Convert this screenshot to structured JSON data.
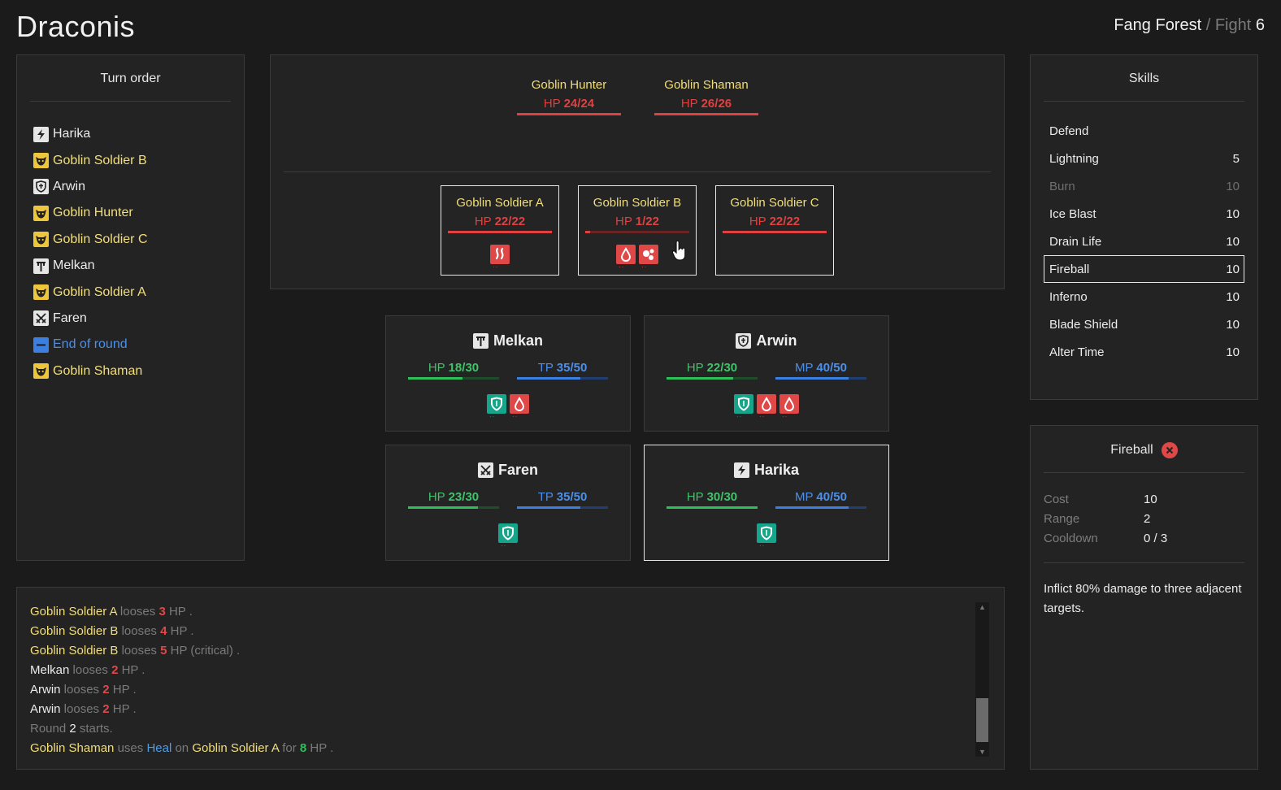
{
  "app": {
    "title": "Draconis"
  },
  "location": {
    "name": "Fang Forest",
    "separator": "/",
    "fight_label": "Fight",
    "fight_number": "6"
  },
  "turn_order": {
    "title": "Turn order",
    "items": [
      {
        "label": "Harika",
        "icon": "lightning-icon",
        "kind": "hero"
      },
      {
        "label": "Goblin Soldier B",
        "icon": "goblin-icon",
        "kind": "enemy"
      },
      {
        "label": "Arwin",
        "icon": "shield-cross-icon",
        "kind": "hero"
      },
      {
        "label": "Goblin Hunter",
        "icon": "goblin-icon",
        "kind": "enemy"
      },
      {
        "label": "Goblin Soldier C",
        "icon": "goblin-icon",
        "kind": "enemy"
      },
      {
        "label": "Melkan",
        "icon": "hammer-icon",
        "kind": "hero"
      },
      {
        "label": "Goblin Soldier A",
        "icon": "goblin-icon",
        "kind": "enemy"
      },
      {
        "label": "Faren",
        "icon": "crossed-swords-icon",
        "kind": "hero"
      },
      {
        "label": "End of round",
        "icon": "dash-icon",
        "kind": "marker"
      },
      {
        "label": "Goblin Shaman",
        "icon": "goblin-icon",
        "kind": "enemy"
      }
    ]
  },
  "enemies_back": [
    {
      "name": "Goblin Hunter",
      "hp_label": "HP",
      "hp": "24/24",
      "hp_fraction": 1.0
    },
    {
      "name": "Goblin Shaman",
      "hp_label": "HP",
      "hp": "26/26",
      "hp_fraction": 1.0
    }
  ],
  "enemies_front": [
    {
      "name": "Goblin Soldier A",
      "hp_label": "HP",
      "hp": "22/22",
      "hp_fraction": 1.0,
      "statuses": [
        {
          "icon": "burn-icon",
          "color": "red"
        }
      ]
    },
    {
      "name": "Goblin Soldier B",
      "hp_label": "HP",
      "hp": "1/22",
      "hp_fraction": 0.045,
      "statuses": [
        {
          "icon": "blood-drop-icon",
          "color": "red"
        },
        {
          "icon": "poison-icon",
          "color": "red"
        }
      ]
    },
    {
      "name": "Goblin Soldier C",
      "hp_label": "HP",
      "hp": "22/22",
      "hp_fraction": 1.0,
      "statuses": []
    }
  ],
  "heroes": {
    "melkan": {
      "name": "Melkan",
      "hp_label": "HP",
      "hp": "18/30",
      "hp_fraction": 0.6,
      "res_label": "TP",
      "res": "35/50",
      "res_fraction": 0.7
    },
    "arwin": {
      "name": "Arwin",
      "hp_label": "HP",
      "hp": "22/30",
      "hp_fraction": 0.73,
      "res_label": "MP",
      "res": "40/50",
      "res_fraction": 0.8
    },
    "faren": {
      "name": "Faren",
      "hp_label": "HP",
      "hp": "23/30",
      "hp_fraction": 0.77,
      "res_label": "TP",
      "res": "35/50",
      "res_fraction": 0.7
    },
    "harika": {
      "name": "Harika",
      "hp_label": "HP",
      "hp": "30/30",
      "hp_fraction": 1.0,
      "res_label": "MP",
      "res": "40/50",
      "res_fraction": 0.8
    }
  },
  "skills": {
    "title": "Skills",
    "items": [
      {
        "name": "Defend",
        "cost": "",
        "disabled": false,
        "selected": false
      },
      {
        "name": "Lightning",
        "cost": "5",
        "disabled": false,
        "selected": false
      },
      {
        "name": "Burn",
        "cost": "10",
        "disabled": true,
        "selected": false
      },
      {
        "name": "Ice Blast",
        "cost": "10",
        "disabled": false,
        "selected": false
      },
      {
        "name": "Drain Life",
        "cost": "10",
        "disabled": false,
        "selected": false
      },
      {
        "name": "Fireball",
        "cost": "10",
        "disabled": false,
        "selected": true
      },
      {
        "name": "Inferno",
        "cost": "10",
        "disabled": false,
        "selected": false
      },
      {
        "name": "Blade Shield",
        "cost": "10",
        "disabled": false,
        "selected": false
      },
      {
        "name": "Alter Time",
        "cost": "10",
        "disabled": false,
        "selected": false
      }
    ]
  },
  "skill_detail": {
    "name": "Fireball",
    "cost_label": "Cost",
    "cost": "10",
    "range_label": "Range",
    "range": "2",
    "cooldown_label": "Cooldown",
    "cooldown": "0 / 3",
    "description": "Inflict 80% damage to three adjacent targets."
  },
  "log": {
    "lines": [
      [
        {
          "t": "Goblin Soldier A",
          "c": "yellow"
        },
        {
          "t": " looses ",
          "c": "gray"
        },
        {
          "t": "3",
          "c": "red"
        },
        {
          "t": " HP .",
          "c": "gray"
        }
      ],
      [
        {
          "t": "Goblin Soldier B",
          "c": "yellow"
        },
        {
          "t": " looses ",
          "c": "gray"
        },
        {
          "t": "4",
          "c": "red"
        },
        {
          "t": " HP .",
          "c": "gray"
        }
      ],
      [
        {
          "t": "Goblin Soldier B",
          "c": "yellow"
        },
        {
          "t": " looses ",
          "c": "gray"
        },
        {
          "t": "5",
          "c": "red"
        },
        {
          "t": " HP (critical) .",
          "c": "gray"
        }
      ],
      [
        {
          "t": "Melkan",
          "c": "white"
        },
        {
          "t": " looses ",
          "c": "gray"
        },
        {
          "t": "2",
          "c": "red"
        },
        {
          "t": " HP .",
          "c": "gray"
        }
      ],
      [
        {
          "t": "Arwin",
          "c": "white"
        },
        {
          "t": " looses ",
          "c": "gray"
        },
        {
          "t": "2",
          "c": "red"
        },
        {
          "t": " HP .",
          "c": "gray"
        }
      ],
      [
        {
          "t": "Arwin",
          "c": "white"
        },
        {
          "t": " looses ",
          "c": "gray"
        },
        {
          "t": "2",
          "c": "red"
        },
        {
          "t": " HP .",
          "c": "gray"
        }
      ],
      [
        {
          "t": "Round ",
          "c": "gray"
        },
        {
          "t": "2",
          "c": "white"
        },
        {
          "t": " starts.",
          "c": "gray"
        }
      ],
      [
        {
          "t": "Goblin Shaman",
          "c": "yellow"
        },
        {
          "t": " uses ",
          "c": "gray"
        },
        {
          "t": "Heal",
          "c": "blue"
        },
        {
          "t": " on ",
          "c": "gray"
        },
        {
          "t": "Goblin Soldier A",
          "c": "yellow"
        },
        {
          "t": " for ",
          "c": "gray"
        },
        {
          "t": "8",
          "c": "green"
        },
        {
          "t": " HP .",
          "c": "gray"
        }
      ]
    ]
  }
}
